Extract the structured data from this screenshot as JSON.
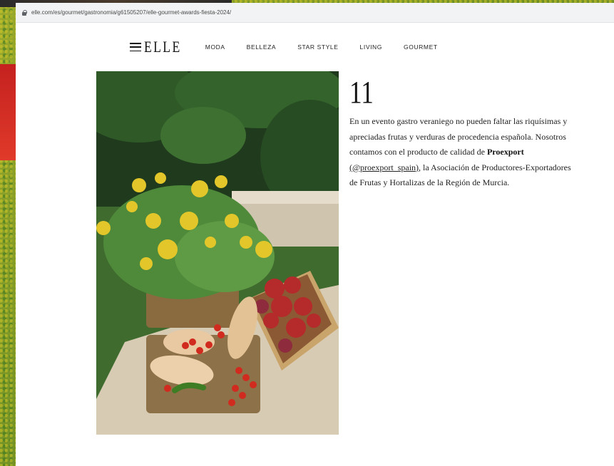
{
  "browser": {
    "url": "elle.com/es/gourmet/gastronomia/g61505207/elle-gourmet-awards-fiesta-2024/"
  },
  "header": {
    "logo": "ELLE",
    "nav": [
      "MODA",
      "BELLEZA",
      "STAR STYLE",
      "LIVING",
      "GOURMET"
    ]
  },
  "article": {
    "number": "11",
    "text_before_bold": "En un evento gastro veraniego no pueden faltar las riquísimas y apreciadas frutas y verduras de procedencia española. Nosotros contamos con el producto de calidad de ",
    "bold_brand": "Proexport",
    "link_text": "(@proexport_spain)",
    "text_after_link": ", la Asociación de Productores-Exportadores de Frutas y Hortalizas de la Región de Murcia."
  },
  "colors": {
    "accent_text": "#111111",
    "body_text": "#222222"
  }
}
